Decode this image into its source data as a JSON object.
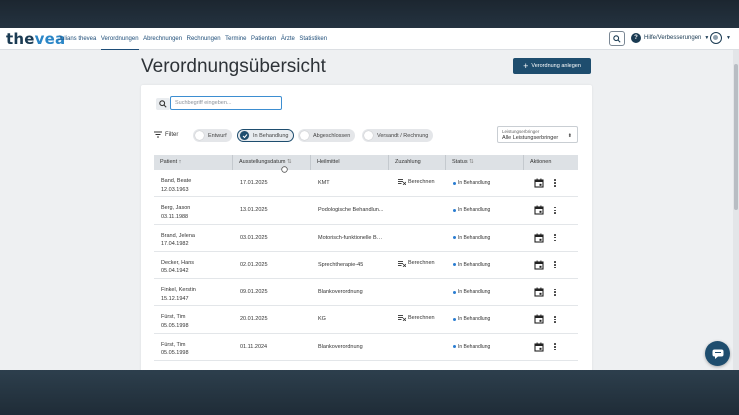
{
  "nav": {
    "logo_a": "the",
    "logo_b": "vea",
    "links": [
      "Julians thevea",
      "Verordnungen",
      "Abrechnungen",
      "Rechnungen",
      "Termine",
      "Patienten",
      "Ärzte",
      "Statistiken"
    ],
    "active_index": 1,
    "help_icon": "?",
    "help_label": "Hilfe/Verbesserungen"
  },
  "page": {
    "title": "Verordnungsübersicht",
    "add_button": "Verordnung anlegen"
  },
  "search": {
    "placeholder": "Suchbegriff eingeben..."
  },
  "filters": {
    "label": "Filter",
    "chips": [
      "Entwurf",
      "In Behandlung",
      "Abgeschlossen",
      "Versandt / Rechnung"
    ],
    "active_chip": "In Behandlung"
  },
  "provider_select": {
    "label": "Leistungserbringer",
    "value": "Alle Leistungserbringer"
  },
  "table": {
    "headers": {
      "patient": "Patient",
      "date": "Ausstellungsdatum",
      "remedy": "Heilmittel",
      "zuzahlung": "Zuzahlung",
      "status": "Status",
      "actions": "Aktionen"
    },
    "rows": [
      {
        "name": "Band, Beate",
        "dob": "12.03.1963",
        "date": "17.01.2025",
        "remedy": "KMT",
        "zuzahlung": "Berechnen",
        "status": "In Behandlung"
      },
      {
        "name": "Berg, Jason",
        "dob": "03.11.1988",
        "date": "13.01.2025",
        "remedy": "Podologische Behandlun...",
        "zuzahlung": "",
        "status": "In Behandlung"
      },
      {
        "name": "Brand, Jelena",
        "dob": "17.04.1982",
        "date": "03.01.2025",
        "remedy": "Motorisch-funktionelle Be...",
        "zuzahlung": "",
        "status": "In Behandlung"
      },
      {
        "name": "Decker, Hans",
        "dob": "05.04.1942",
        "date": "02.01.2025",
        "remedy": "Sprechtherapie-45",
        "zuzahlung": "Berechnen",
        "status": "In Behandlung"
      },
      {
        "name": "Finkel, Kerstin",
        "dob": "15.12.1947",
        "date": "09.01.2025",
        "remedy": "Blankoverordnung",
        "zuzahlung": "",
        "status": "In Behandlung"
      },
      {
        "name": "Fürst, Tim",
        "dob": "05.05.1998",
        "date": "20.01.2025",
        "remedy": "KG",
        "zuzahlung": "Berechnen",
        "status": "In Behandlung"
      },
      {
        "name": "Fürst, Tim",
        "dob": "05.05.1998",
        "date": "01.11.2024",
        "remedy": "Blankoverordnung",
        "zuzahlung": "",
        "status": "In Behandlung"
      }
    ]
  },
  "colors": {
    "primary": "#1e4d6e",
    "status_blue": "#2a7dd1",
    "nav_text": "#1e4d78"
  }
}
